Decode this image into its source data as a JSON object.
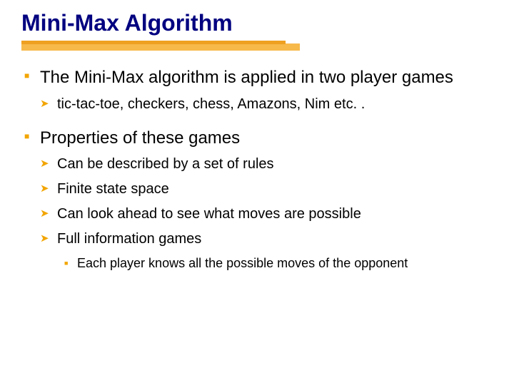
{
  "title": "Mini-Max Algorithm",
  "bullets": {
    "b1": "The Mini-Max algorithm is applied in two player games",
    "b1_1": "tic-tac-toe, checkers, chess, Amazons, Nim etc. .",
    "b2": "Properties of these games",
    "b2_1": "Can be described by a set of rules",
    "b2_2": "Finite state space",
    "b2_3": "Can look ahead to see what moves are possible",
    "b2_4": "Full information games",
    "b2_4_1": "Each player knows all the possible moves of the opponent"
  }
}
